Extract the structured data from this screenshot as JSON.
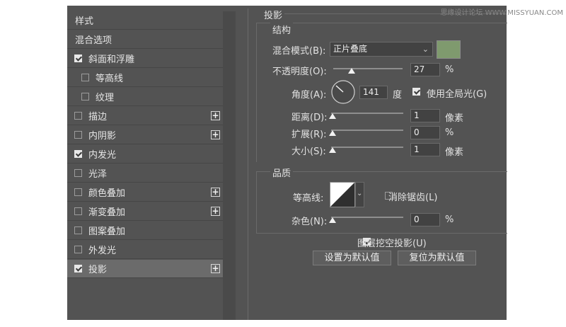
{
  "watermark": "思缘设计论坛 WWW.MISSYUAN.COM",
  "styles_panel": {
    "items": [
      {
        "label": "样式",
        "checkbox": false,
        "plus": false
      },
      {
        "label": "混合选项",
        "checkbox": false,
        "plus": false
      },
      {
        "label": "斜面和浮雕",
        "checkbox": true,
        "checked": true,
        "plus": false
      },
      {
        "label": "等高线",
        "checkbox": true,
        "checked": false,
        "plus": false,
        "indent": true
      },
      {
        "label": "纹理",
        "checkbox": true,
        "checked": false,
        "plus": false,
        "indent": true
      },
      {
        "label": "描边",
        "checkbox": true,
        "checked": false,
        "plus": true
      },
      {
        "label": "内阴影",
        "checkbox": true,
        "checked": false,
        "plus": true
      },
      {
        "label": "内发光",
        "checkbox": true,
        "checked": true,
        "plus": false
      },
      {
        "label": "光泽",
        "checkbox": true,
        "checked": false,
        "plus": false
      },
      {
        "label": "颜色叠加",
        "checkbox": true,
        "checked": false,
        "plus": true
      },
      {
        "label": "渐变叠加",
        "checkbox": true,
        "checked": false,
        "plus": true
      },
      {
        "label": "图案叠加",
        "checkbox": true,
        "checked": false,
        "plus": false
      },
      {
        "label": "外发光",
        "checkbox": true,
        "checked": false,
        "plus": false
      },
      {
        "label": "投影",
        "checkbox": true,
        "checked": true,
        "plus": true,
        "selected": true
      }
    ],
    "plus_symbol": "+"
  },
  "drop_shadow": {
    "section_title": "投影",
    "structure_title": "结构",
    "blend_mode_label": "混合模式(B):",
    "blend_mode_value": "正片叠底",
    "shadow_color": "#7f9a6e",
    "opacity_label": "不透明度(O):",
    "opacity_value": "27",
    "opacity_percent": 27,
    "angle_label": "角度(A):",
    "angle_value": "141",
    "angle_unit": "度",
    "global_light_label": "使用全局光(G)",
    "global_light_checked": true,
    "distance_label": "距离(D):",
    "distance_value": "1",
    "distance_unit": "像素",
    "spread_label": "扩展(R):",
    "spread_value": "0",
    "size_label": "大小(S):",
    "size_value": "1",
    "size_unit": "像素",
    "percent_sign": "%",
    "quality_title": "品质",
    "contour_label": "等高线:",
    "anti_alias_label": "消除锯齿(L)",
    "anti_alias_checked": false,
    "noise_label": "杂色(N):",
    "noise_value": "0",
    "knockout_label": "图层挖空投影(U)",
    "knockout_checked": true,
    "make_default_label": "设置为默认值",
    "reset_default_label": "复位为默认值"
  },
  "colors": {
    "panel_bg": "#535353",
    "selected_row": "#6b6b6b",
    "shadow_swatch": "#7f9a6e"
  },
  "icons": [
    "checkbox-icon",
    "plus-icon",
    "chevron-down-icon",
    "angle-dial-icon",
    "contour-preview-icon"
  ]
}
